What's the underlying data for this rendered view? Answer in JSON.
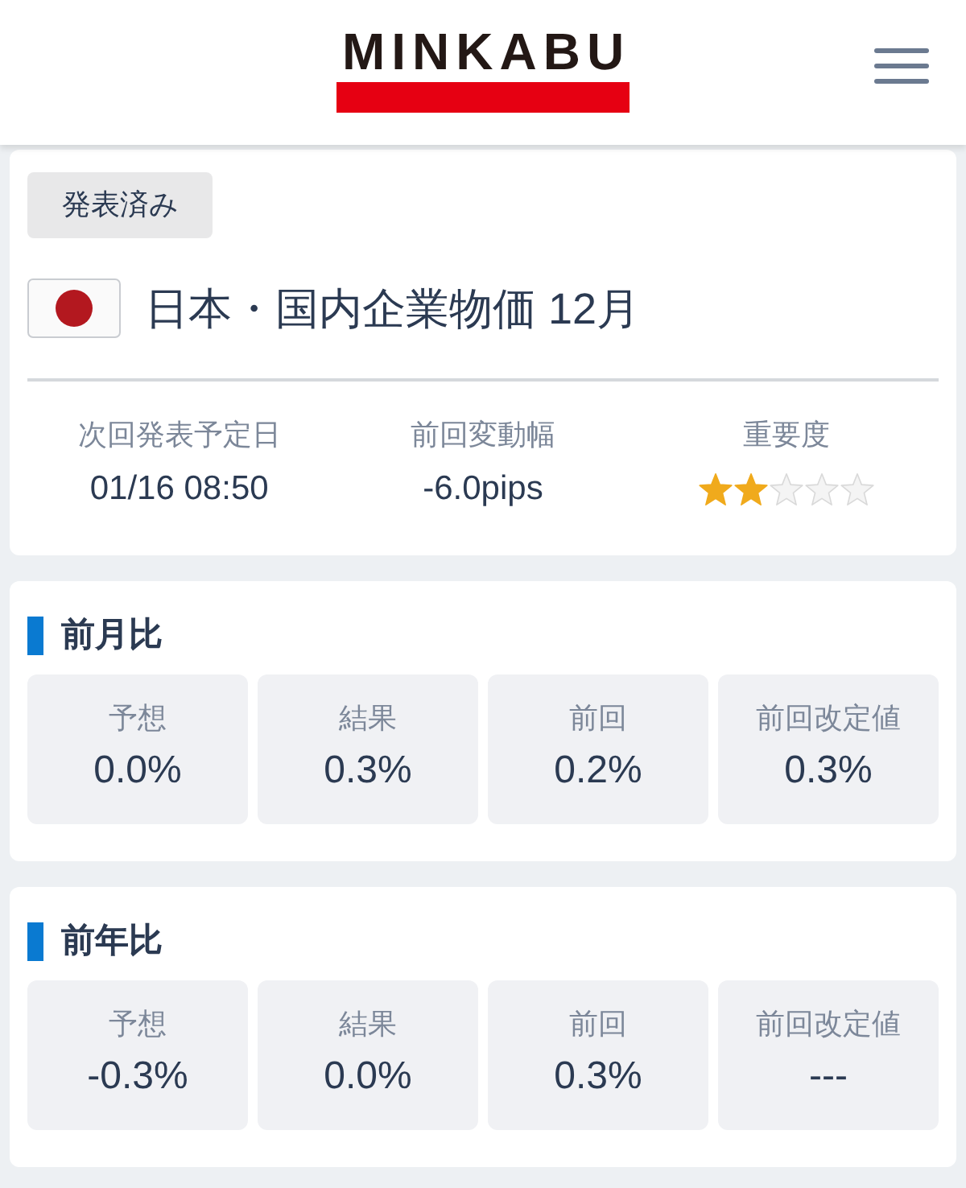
{
  "header": {
    "logo": "MINKABU"
  },
  "event": {
    "status_badge": "発表済み",
    "title": "日本・国内企業物価 12月",
    "stats": [
      {
        "kind": "text",
        "label": "次回発表予定日",
        "value": "01/16 08:50"
      },
      {
        "kind": "text",
        "label": "前回変動幅",
        "value": "-6.0pips"
      },
      {
        "kind": "stars",
        "label": "重要度",
        "stars": 2
      }
    ]
  },
  "sections": [
    {
      "heading": "前月比",
      "cells": [
        {
          "label": "予想",
          "value": "0.0%"
        },
        {
          "label": "結果",
          "value": "0.3%"
        },
        {
          "label": "前回",
          "value": "0.2%"
        },
        {
          "label": "前回改定値",
          "value": "0.3%"
        }
      ]
    },
    {
      "heading": "前年比",
      "cells": [
        {
          "label": "予想",
          "value": "-0.3%"
        },
        {
          "label": "結果",
          "value": "0.0%"
        },
        {
          "label": "前回",
          "value": "0.3%"
        },
        {
          "label": "前回改定値",
          "value": "---"
        }
      ]
    }
  ]
}
